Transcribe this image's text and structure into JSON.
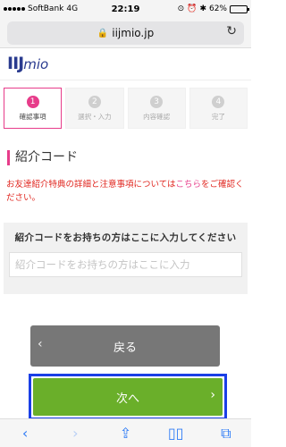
{
  "status_bar": {
    "carrier": "SoftBank",
    "network": "4G",
    "time": "22:19",
    "battery": "62%",
    "battery_level": 0.62
  },
  "browser": {
    "url": "iijmio.jp"
  },
  "logo": {
    "main": "IIJ",
    "sub": "mio"
  },
  "steps": [
    {
      "num": "1",
      "label": "確認事項",
      "active": true
    },
    {
      "num": "2",
      "label": "選択・入力",
      "active": false
    },
    {
      "num": "3",
      "label": "内容確認",
      "active": false
    },
    {
      "num": "4",
      "label": "完了",
      "active": false
    }
  ],
  "section": {
    "title": "紹介コード",
    "notice_before": "お友達紹介特典の詳細と注意事項については",
    "notice_link": "こちら",
    "notice_after": "をご確認ください。"
  },
  "form": {
    "label": "紹介コードをお持ちの方はここに入力してください",
    "placeholder": "紹介コードをお持ちの方はここに入力",
    "value": ""
  },
  "buttons": {
    "back": "戻る",
    "next": "次へ"
  },
  "colors": {
    "accent": "#e73c8a",
    "next": "#6aaf2a",
    "back": "#777777",
    "highlight": "#1a3fe6"
  }
}
